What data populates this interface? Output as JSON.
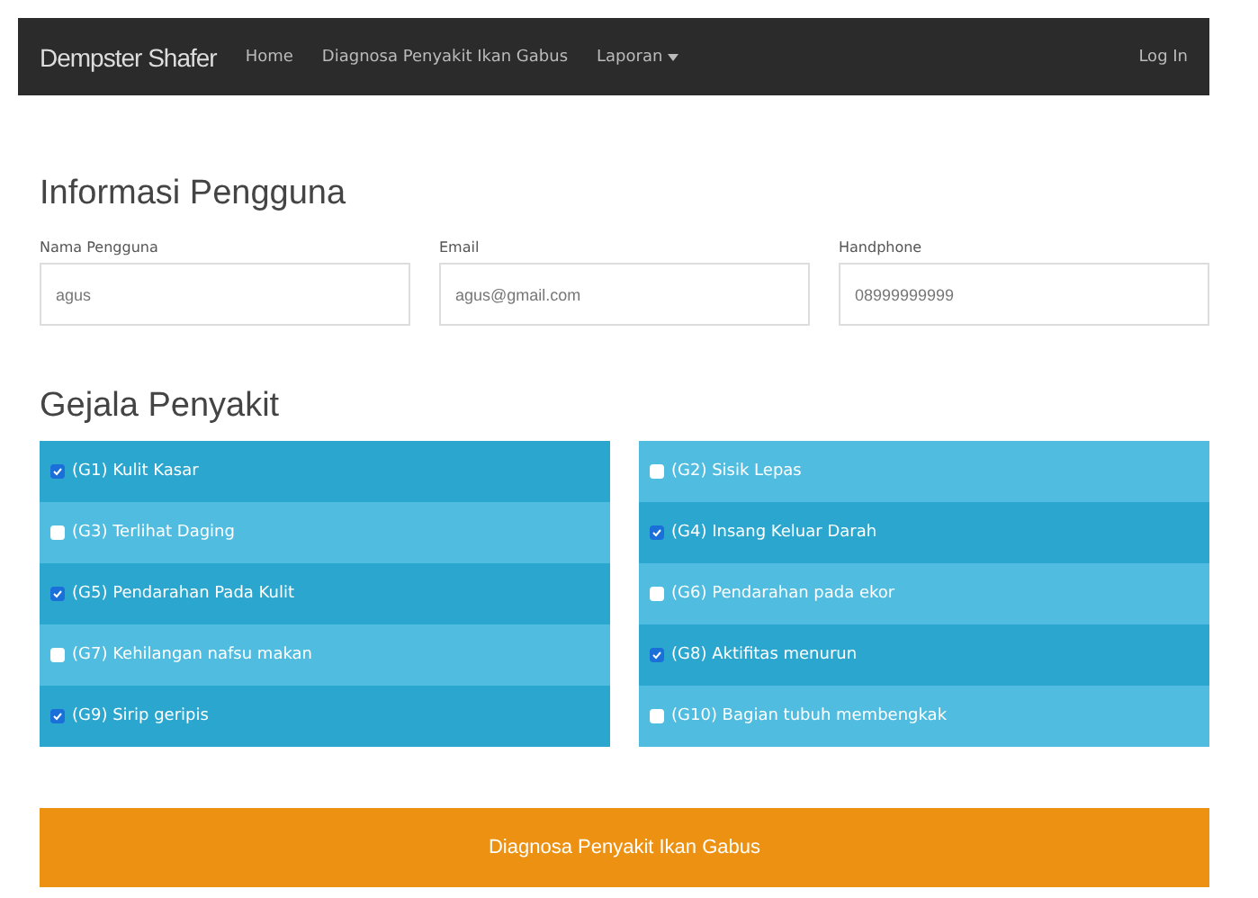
{
  "navbar": {
    "brand": "Dempster Shafer",
    "links": [
      {
        "label": "Home",
        "dropdown": false
      },
      {
        "label": "Diagnosa Penyakit Ikan Gabus",
        "dropdown": false
      },
      {
        "label": "Laporan",
        "dropdown": true
      }
    ],
    "login": "Log In"
  },
  "user_info": {
    "title": "Informasi Pengguna",
    "fields": [
      {
        "label": "Nama Pengguna",
        "value": "agus"
      },
      {
        "label": "Email",
        "value": "agus@gmail.com"
      },
      {
        "label": "Handphone",
        "value": "08999999999"
      }
    ]
  },
  "symptoms": {
    "title": "Gejala Penyakit",
    "columns": [
      [
        {
          "label": "(G1) Kulit Kasar",
          "checked": true
        },
        {
          "label": "(G3) Terlihat Daging",
          "checked": false
        },
        {
          "label": "(G5) Pendarahan Pada Kulit",
          "checked": true
        },
        {
          "label": "(G7) Kehilangan nafsu makan",
          "checked": false
        },
        {
          "label": "(G9) Sirip geripis",
          "checked": true
        }
      ],
      [
        {
          "label": "(G2) Sisik Lepas",
          "checked": false
        },
        {
          "label": "(G4) Insang Keluar Darah",
          "checked": true
        },
        {
          "label": "(G6) Pendarahan pada ekor",
          "checked": false
        },
        {
          "label": "(G8) Aktifitas menurun",
          "checked": true
        },
        {
          "label": "(G10) Bagian tubuh membengkak",
          "checked": false
        }
      ]
    ]
  },
  "submit_button": "Diagnosa Penyakit Ikan Gabus"
}
